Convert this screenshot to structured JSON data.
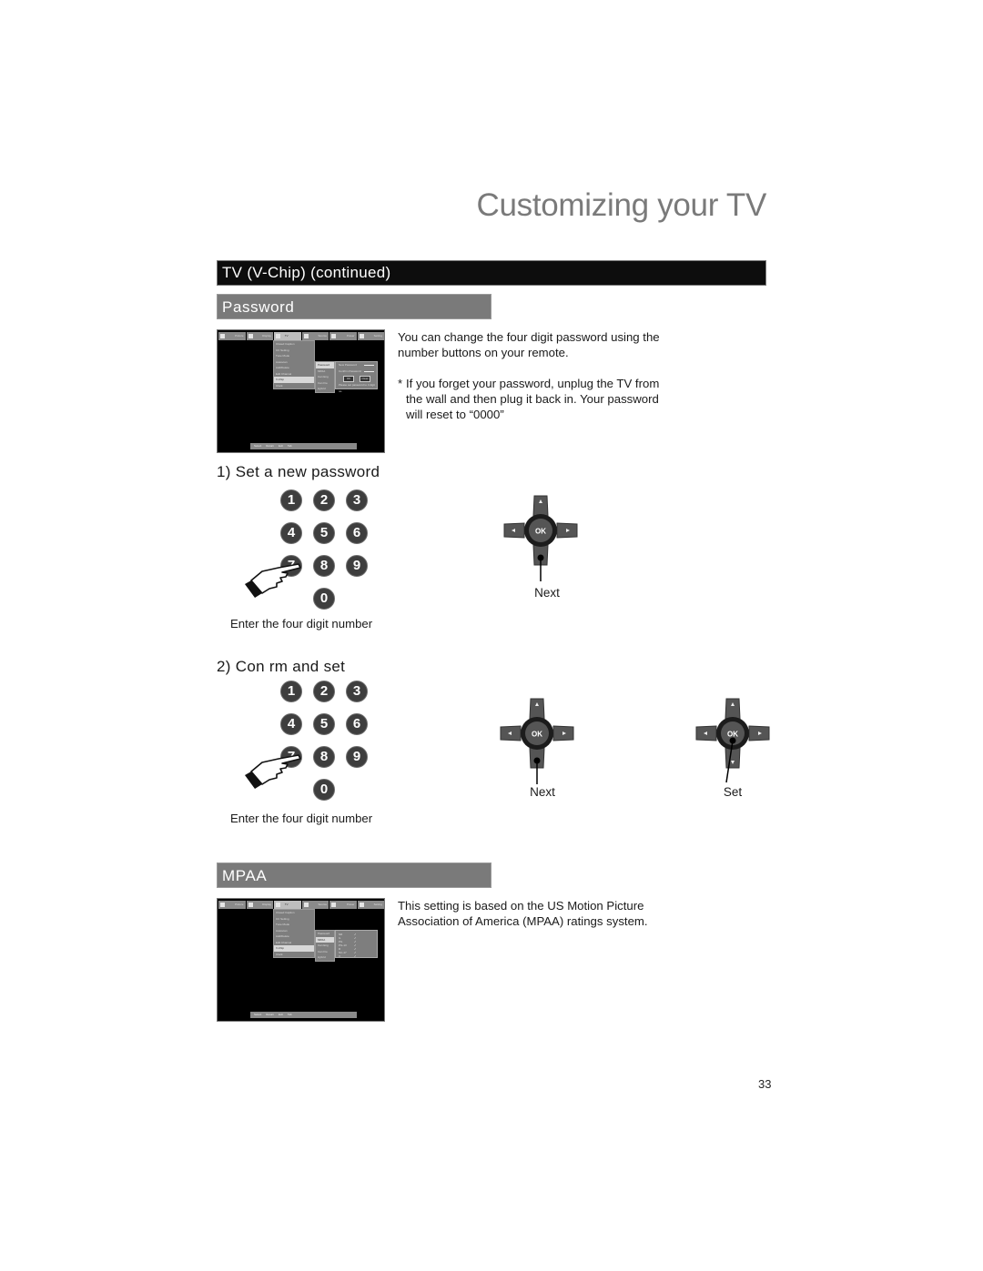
{
  "page": {
    "title": "Customizing your TV",
    "section_header": "TV (V-Chip) (continued)",
    "page_number": "33"
  },
  "password_section": {
    "header": "Password",
    "intro": "You can change the four digit password using the number buttons on your remote.",
    "note_marker": "*",
    "note": "If you forget your password, unplug the TV from the wall and then plug it back in.  Your password will reset to “0000”",
    "screen": {
      "tabs": [
        "Picture",
        "Display",
        "TV",
        "Source",
        "Power",
        "Setting"
      ],
      "active_tab": "TV",
      "menu": [
        "Closed Caption",
        "CC Setting",
        "Tune Mode",
        "Autoscan",
        "Add/Delete",
        "Edit Channel",
        "V-Chip",
        "Clock"
      ],
      "menu_selected": "V-Chip",
      "submenu": [
        "Password",
        "MPAA",
        "Can Eng",
        "Can Fre",
        "Hybrid"
      ],
      "submenu_selected": "Password",
      "panel": {
        "new_password_label": "New Password",
        "confirm_password_label": "Confirm Password",
        "ok_label": "OK",
        "clear_label": "Clear",
        "hint": "Please set password to 4 digit no."
      },
      "bottom_bar": [
        "Select",
        "Return",
        "Exit",
        "Tab"
      ]
    },
    "steps": [
      {
        "title": "1)  Set a new password",
        "keypad_caption": "Enter the four digit number",
        "buttons": [
          {
            "label": "Next",
            "pressed": "down"
          }
        ]
      },
      {
        "title": "2)  Con  rm and set",
        "keypad_caption": "Enter the four digit number",
        "buttons": [
          {
            "label": "Next",
            "pressed": "down"
          },
          {
            "label": "Set",
            "pressed": "ok"
          }
        ]
      }
    ],
    "keypad_keys": [
      "1",
      "2",
      "3",
      "4",
      "5",
      "6",
      "7",
      "8",
      "9",
      "0"
    ],
    "dpad": {
      "center_label": "OK"
    }
  },
  "mpaa_section": {
    "header": "MPAA",
    "text": "This setting is based on the US Motion Picture Association of America (MPAA) ratings system.",
    "screen": {
      "tabs": [
        "Picture",
        "Display",
        "TV",
        "Source",
        "Power",
        "Setting"
      ],
      "active_tab": "TV",
      "menu": [
        "Closed Caption",
        "CC Setting",
        "Tune Mode",
        "Autoscan",
        "Add/Delete",
        "Edit Channel",
        "V-Chip",
        "Clock"
      ],
      "menu_selected": "V-Chip",
      "submenu": [
        "Password",
        "MPAA",
        "Can Eng",
        "Can Fre",
        "Hybrid"
      ],
      "submenu_selected": "MPAA",
      "ratings": [
        "NR",
        "G",
        "PG",
        "PG-13",
        "R",
        "NC-17",
        "X"
      ],
      "check_glyph": "✓",
      "bottom_bar": [
        "Select",
        "Return",
        "Exit",
        "Tab"
      ]
    }
  }
}
